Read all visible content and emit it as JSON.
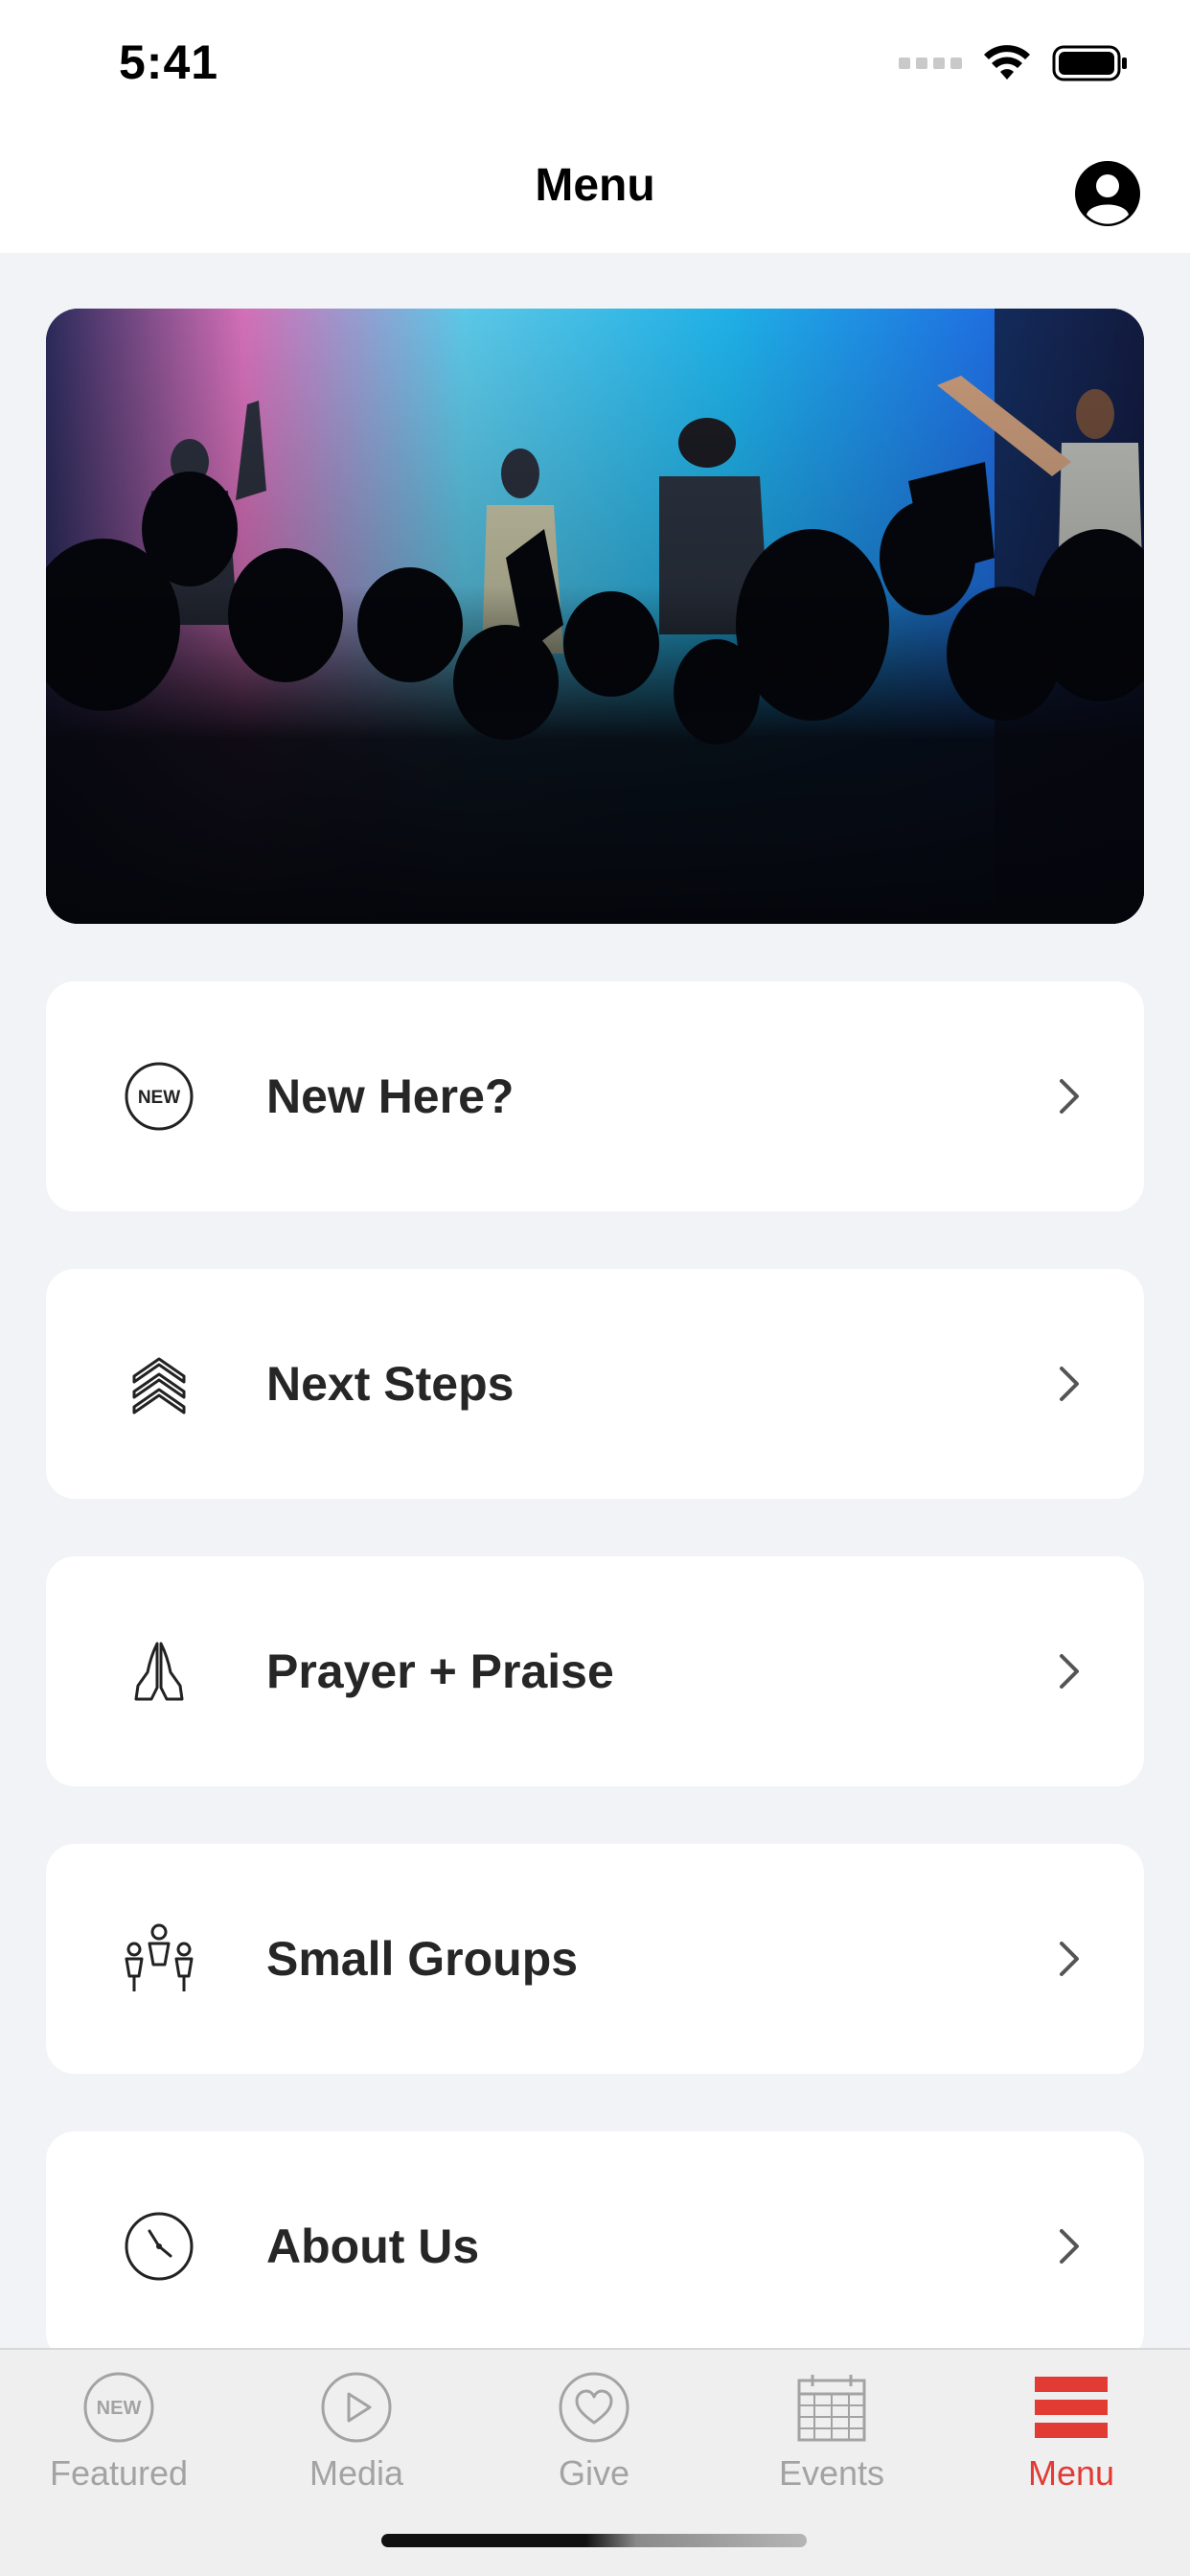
{
  "status": {
    "time": "5:41"
  },
  "nav": {
    "title": "Menu"
  },
  "menu": {
    "items": [
      {
        "label": "New Here?",
        "icon": "new-badge-icon"
      },
      {
        "label": "Next Steps",
        "icon": "chevrons-up-icon"
      },
      {
        "label": "Prayer + Praise",
        "icon": "praying-hands-icon"
      },
      {
        "label": "Small Groups",
        "icon": "small-groups-icon"
      },
      {
        "label": "About Us",
        "icon": "clock-icon"
      }
    ]
  },
  "tabs": {
    "featured": "Featured",
    "media": "Media",
    "give": "Give",
    "events": "Events",
    "menu": "Menu",
    "new_badge": "NEW",
    "active": "Menu"
  },
  "badge": {
    "new": "NEW"
  },
  "colors": {
    "accent": "#e23b33",
    "inactive": "#a3a3a3",
    "background": "#f2f3f7",
    "card": "#ffffff"
  }
}
